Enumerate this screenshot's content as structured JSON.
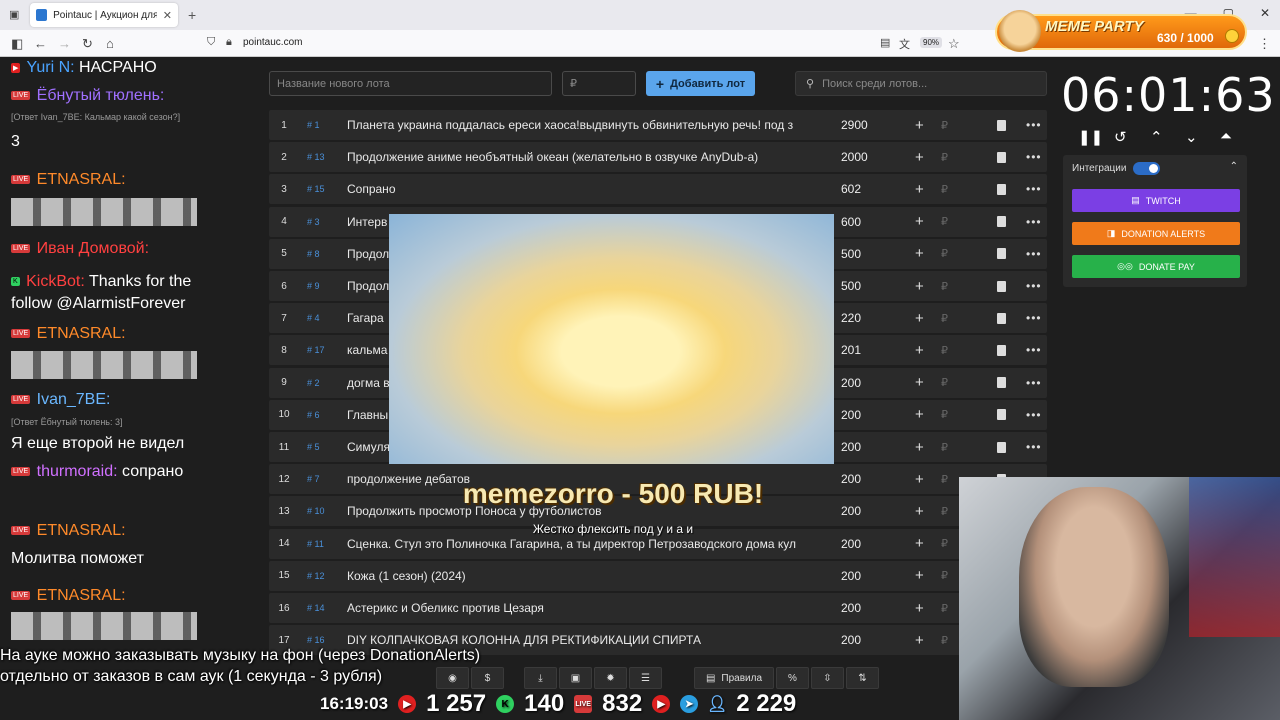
{
  "browser": {
    "tab_title": "Pointauc | Аукцион для стриме",
    "url": "pointauc.com",
    "zoom": "90%"
  },
  "meme_party": {
    "title": "MEME PARTY",
    "counter": "630 / 1000"
  },
  "chat": [
    {
      "nick": "Yuri N:",
      "text": "НАСРАНО",
      "nick_color": "#4aa3ff"
    },
    {
      "nick": "Ёбнутый тюлень:",
      "text": "",
      "nick_color": "#a070ff"
    },
    {
      "reply": "[Ответ Ivan_7BE: Кальмар какой сезон?]"
    },
    {
      "text": "3"
    },
    {
      "nick": "ЕТNАSRАL:",
      "text": "",
      "nick_color": "#ff8a2a"
    },
    {
      "nick": "Иван Домовой:",
      "text": "",
      "nick_color": "#ff4040"
    },
    {
      "nick": "KickBot:",
      "text": "Thanks for the",
      "nick_color": "#ff4040"
    },
    {
      "text": "follow @AlarmistForever"
    },
    {
      "nick": "ЕТNАSRАL:",
      "text": "",
      "nick_color": "#ff8a2a"
    },
    {
      "nick": "Ivan_7BE:",
      "text": "",
      "nick_color": "#6ab7ff"
    },
    {
      "reply": "[Ответ Ёбнутый тюлень: 3]"
    },
    {
      "text": "Я еще второй не видел"
    },
    {
      "nick": "thurmoraid:",
      "text": "сопрано",
      "nick_color": "#d070ff"
    },
    {
      "nick": "ЕТNАSRАL:",
      "text": "",
      "nick_color": "#ff8a2a"
    },
    {
      "text": "Молитва поможет"
    },
    {
      "nick": "ЕТNАSRАL:",
      "text": "",
      "nick_color": "#ff8a2a"
    }
  ],
  "form": {
    "lot_placeholder": "Название нового лота",
    "amount_placeholder": "₽",
    "add_label": "Добавить лот",
    "search_placeholder": "Поиск среди лотов..."
  },
  "lots": [
    {
      "idx": "1",
      "num": "# 1",
      "name": "Планета украина поддалась ереси хаоса!выдвинуть обвинительную речь! под з",
      "amount": "2900"
    },
    {
      "idx": "2",
      "num": "# 13",
      "name": "Продолжение аниме необъятный океан (желательно в озвучке AnyDub-а)",
      "amount": "2000"
    },
    {
      "idx": "3",
      "num": "# 15",
      "name": "Сопрано",
      "amount": "602"
    },
    {
      "idx": "4",
      "num": "# 3",
      "name": "Интерв",
      "amount": "600"
    },
    {
      "idx": "5",
      "num": "# 8",
      "name": "Продол",
      "amount": "500"
    },
    {
      "idx": "6",
      "num": "# 9",
      "name": "Продол",
      "amount": "500"
    },
    {
      "idx": "7",
      "num": "# 4",
      "name": "Гагара",
      "amount": "220"
    },
    {
      "idx": "8",
      "num": "# 17",
      "name": "кальма",
      "amount": "201"
    },
    {
      "idx": "9",
      "num": "# 2",
      "name": "догма в",
      "amount": "200"
    },
    {
      "idx": "10",
      "num": "# 6",
      "name": "Главны",
      "amount": "200"
    },
    {
      "idx": "11",
      "num": "# 5",
      "name": "Симуля",
      "amount": "200"
    },
    {
      "idx": "12",
      "num": "# 7",
      "name": "продолжение дебатов",
      "amount": "200"
    },
    {
      "idx": "13",
      "num": "# 10",
      "name": "Продолжить просмотр Поноса у футболистов",
      "amount": "200"
    },
    {
      "idx": "14",
      "num": "# 11",
      "name": "Сценка. Стул это Полиночка Гагарина, а ты директор Петрозаводского дома кул",
      "amount": "200"
    },
    {
      "idx": "15",
      "num": "# 12",
      "name": "Кожа (1 сезон) (2024)",
      "amount": "200"
    },
    {
      "idx": "16",
      "num": "# 14",
      "name": "Астерикс и Обеликс против Цезаря",
      "amount": "200"
    },
    {
      "idx": "17",
      "num": "# 16",
      "name": "DIY КОЛПАЧКОВАЯ КОЛОННА ДЛЯ РЕКТИФИКАЦИИ СПИРТА",
      "amount": "200"
    }
  ],
  "timer": {
    "value": "06:01:63"
  },
  "integrations": {
    "label": "Интеграции",
    "twitch": "TWITCH",
    "donation_alerts": "DONATION ALERTS",
    "donate_pay": "DONATE PAY",
    "colors": {
      "twitch": "#7b3fe4",
      "donation_alerts": "#f07a1a",
      "donate_pay": "#27b14a"
    }
  },
  "donation": {
    "title": "memezorro - 500 RUB!",
    "message": "Жестко флексить под у и а и"
  },
  "overlay": {
    "line1": "На ауке можно заказывать музыку на фон (через DonationAlerts)",
    "line2": "отдельно от заказов в сам аук (1 секунда - 3 рубля)"
  },
  "toolbar": {
    "rules_label": "Правила"
  },
  "stats": {
    "time": "16:19:03",
    "youtube": "1 257",
    "kick": "140",
    "live": "832",
    "viewers": "2 229"
  }
}
